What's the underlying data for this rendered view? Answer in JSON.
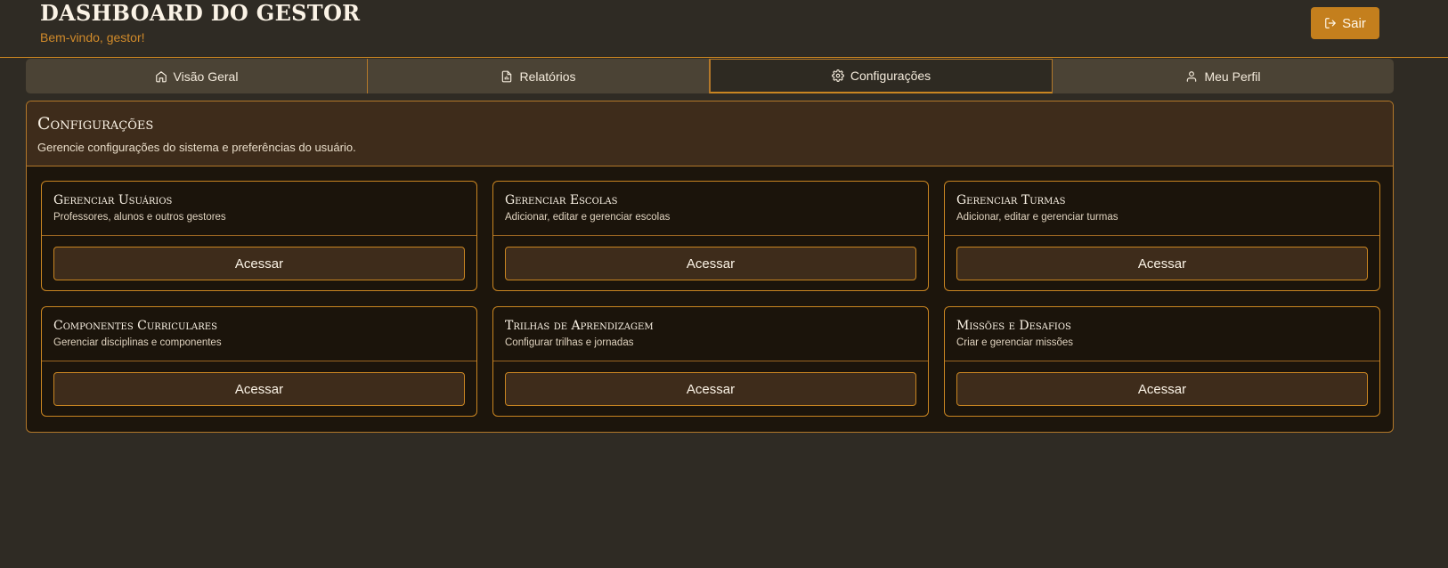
{
  "header": {
    "title": "DASHBOARD DO GESTOR",
    "subtitle": "Bem-vindo, gestor!",
    "logout_label": "Sair"
  },
  "tabs": [
    {
      "label": "Visão Geral",
      "icon": "home-icon"
    },
    {
      "label": "Relatórios",
      "icon": "file-chart-icon"
    },
    {
      "label": "Configurações",
      "icon": "gear-icon",
      "active": true
    },
    {
      "label": "Meu Perfil",
      "icon": "user-icon"
    }
  ],
  "panel": {
    "title": "Configurações",
    "description": "Gerencie configurações do sistema e preferências do usuário."
  },
  "cards": [
    {
      "title": "Gerenciar Usuários",
      "description": "Professores, alunos e outros gestores",
      "button": "Acessar"
    },
    {
      "title": "Gerenciar Escolas",
      "description": "Adicionar, editar e gerenciar escolas",
      "button": "Acessar"
    },
    {
      "title": "Gerenciar Turmas",
      "description": "Adicionar, editar e gerenciar turmas",
      "button": "Acessar"
    },
    {
      "title": "Componentes Curriculares",
      "description": "Gerenciar disciplinas e componentes",
      "button": "Acessar"
    },
    {
      "title": "Trilhas de Aprendizagem",
      "description": "Configurar trilhas e jornadas",
      "button": "Acessar"
    },
    {
      "title": "Missões e Desafios",
      "description": "Criar e gerenciar missões",
      "button": "Acessar"
    }
  ],
  "colors": {
    "background": "#2f2b24",
    "accent": "#c98521",
    "panel_header": "#3e2c1b",
    "card_bg": "#1b140b"
  }
}
